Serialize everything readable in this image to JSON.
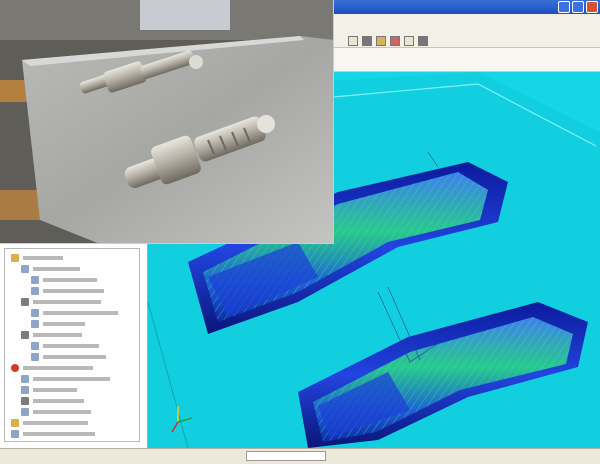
{
  "window": {
    "title_controls": [
      "minimize",
      "maximize",
      "close"
    ]
  },
  "toolbar": {
    "icons": [
      "document-icon",
      "gear-icon",
      "folder-icon",
      "edit-icon",
      "minus-icon",
      "wrench-icon"
    ]
  },
  "tree": {
    "rows": [
      {
        "indent": 0,
        "icon": "folder-icon",
        "label": "",
        "expanded": true
      },
      {
        "indent": 1,
        "icon": "file-icon",
        "label": ""
      },
      {
        "indent": 2,
        "icon": "file-icon",
        "label": ""
      },
      {
        "indent": 2,
        "icon": "file-icon",
        "label": ""
      },
      {
        "indent": 1,
        "icon": "tool-icon",
        "label": ""
      },
      {
        "indent": 2,
        "icon": "file-icon",
        "label": ""
      },
      {
        "indent": 2,
        "icon": "file-icon",
        "label": ""
      },
      {
        "indent": 1,
        "icon": "tool-icon",
        "label": ""
      },
      {
        "indent": 2,
        "icon": "file-icon",
        "label": ""
      },
      {
        "indent": 2,
        "icon": "file-icon",
        "label": ""
      },
      {
        "indent": 0,
        "icon": "warning-icon",
        "label": ""
      },
      {
        "indent": 1,
        "icon": "file-icon",
        "label": ""
      },
      {
        "indent": 1,
        "icon": "file-icon",
        "label": ""
      },
      {
        "indent": 1,
        "icon": "tool-icon",
        "label": ""
      },
      {
        "indent": 1,
        "icon": "file-icon",
        "label": ""
      },
      {
        "indent": 0,
        "icon": "folder-icon",
        "label": ""
      },
      {
        "indent": 0,
        "icon": "file-icon",
        "label": ""
      }
    ]
  },
  "statusbar": {
    "left_text": "",
    "right_text": ""
  },
  "colors": {
    "viewport_bg": "#14d6e6",
    "toolpath_blue": "#1a3fcf",
    "toolpath_green": "#2fbf64",
    "titlebar": "#1d4fc0"
  },
  "photo": {
    "subject": "machined-parts-photo"
  }
}
